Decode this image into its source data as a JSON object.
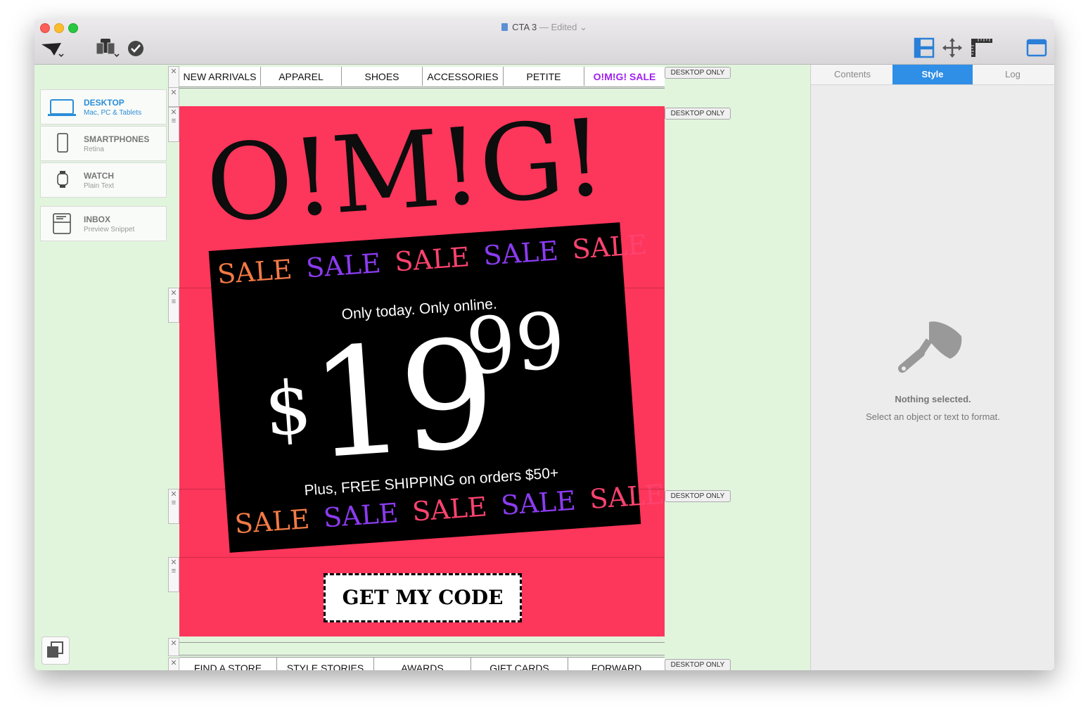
{
  "window": {
    "title": "CTA 3",
    "edited": "— Edited"
  },
  "tabs": [
    {
      "label": "Contents"
    },
    {
      "label": "Style"
    },
    {
      "label": "Log"
    }
  ],
  "style_panel": {
    "heading": "Nothing selected.",
    "hint": "Select an object or text to format."
  },
  "devices": [
    {
      "title": "DESKTOP",
      "subtitle": "Mac, PC & Tablets",
      "icon": "laptop-icon"
    },
    {
      "title": "SMARTPHONES",
      "subtitle": "Retina",
      "icon": "phone-icon"
    },
    {
      "title": "WATCH",
      "subtitle": "Plain Text",
      "icon": "watch-icon"
    },
    {
      "title": "INBOX",
      "subtitle": "Preview Snippet",
      "icon": "inbox-icon"
    }
  ],
  "tag": "DESKTOP ONLY",
  "nav": [
    "NEW ARRIVALS",
    "APPAREL",
    "SHOES",
    "ACCESSORIES",
    "PETITE",
    "O!M!G! SALE"
  ],
  "nav_accent": "#a020f0",
  "hero": {
    "headline": "O!M!G!",
    "sale_word": "SALE",
    "subhead": "Only today. Only online.",
    "price_symbol": "$",
    "price_main": "19",
    "price_cents": "99",
    "shipping": "Plus, FREE SHIPPING on orders $50+",
    "bg_color": "#fd365b"
  },
  "cta": {
    "label": "GET MY CODE"
  },
  "footer_nav": [
    "FIND A STORE",
    "STYLE STORIES",
    "AWARDS",
    "GIFT CARDS",
    "FORWARD"
  ]
}
